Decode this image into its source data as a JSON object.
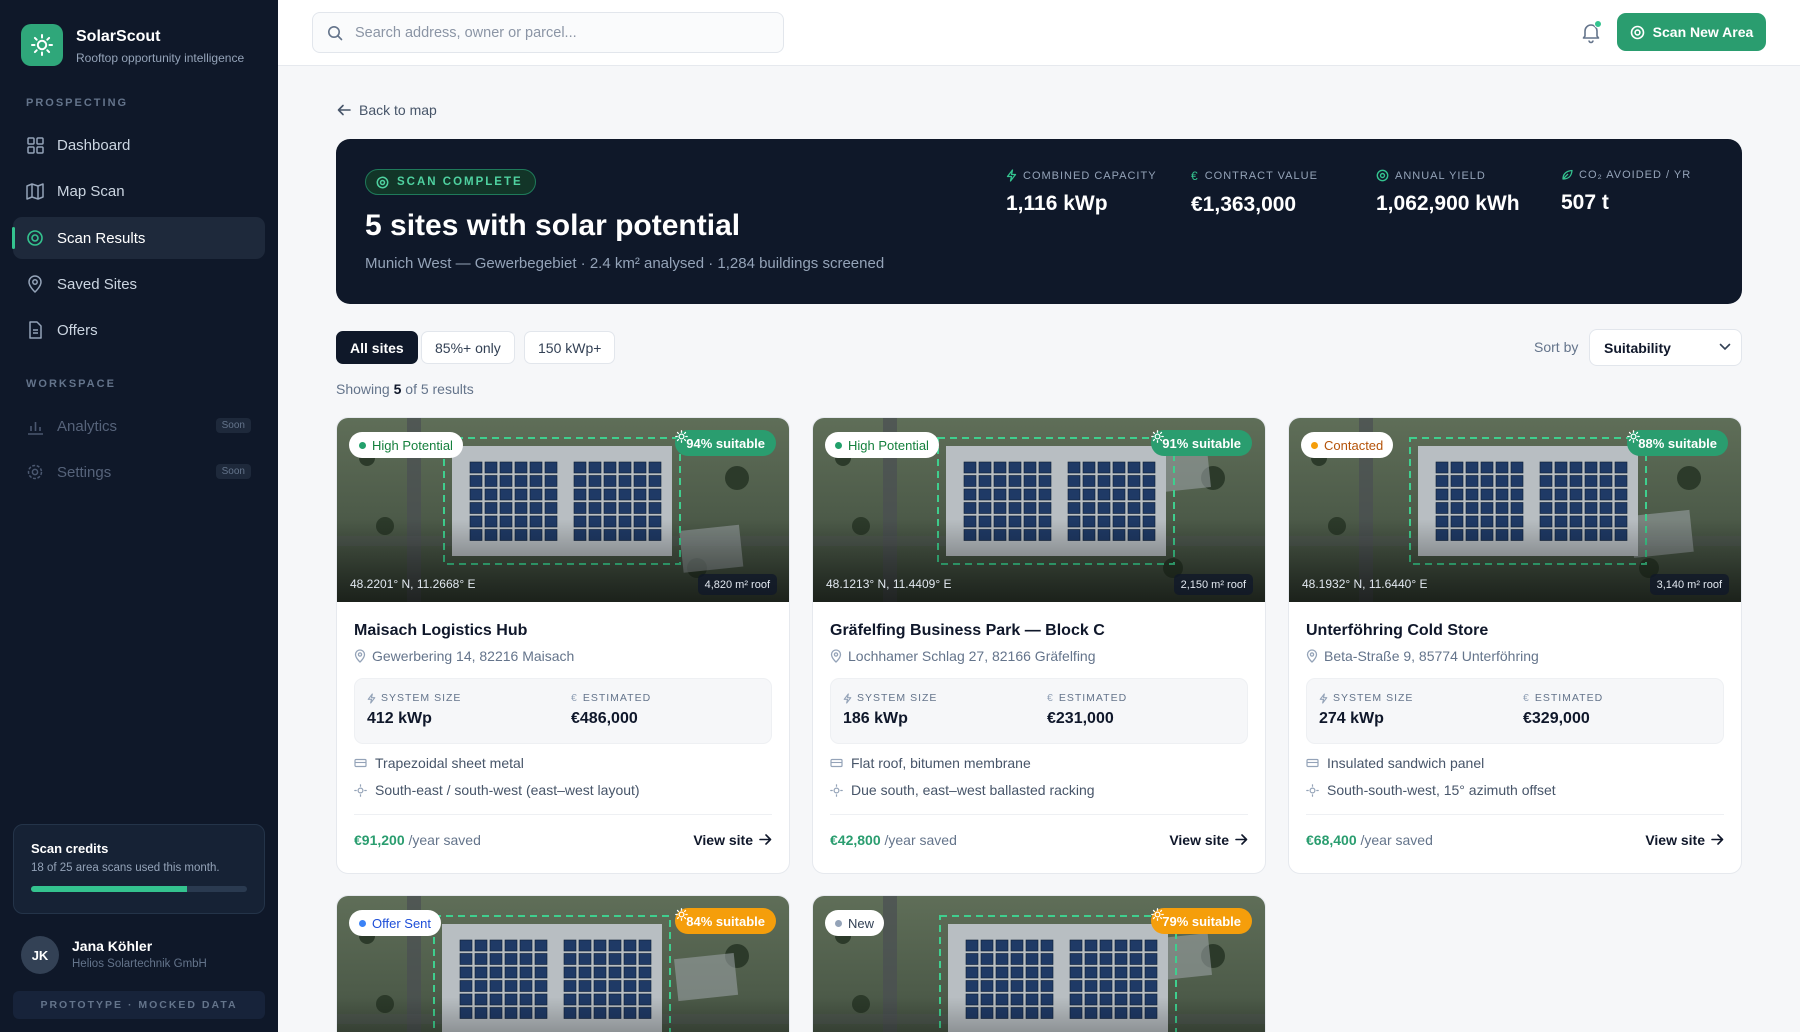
{
  "brand": {
    "name": "SolarScout",
    "tagline": "Rooftop opportunity intelligence"
  },
  "sidebar": {
    "section_prospecting": "PROSPECTING",
    "section_workspace": "WORKSPACE",
    "items": [
      {
        "label": "Dashboard",
        "icon": "grid-icon"
      },
      {
        "label": "Map Scan",
        "icon": "map-icon"
      },
      {
        "label": "Scan Results",
        "icon": "target-icon",
        "active": true
      },
      {
        "label": "Saved Sites",
        "icon": "pin-icon"
      },
      {
        "label": "Offers",
        "icon": "document-icon"
      },
      {
        "label": "Analytics",
        "icon": "bar-chart-icon",
        "badge": "Soon"
      },
      {
        "label": "Settings",
        "icon": "gear-icon",
        "badge": "Soon"
      }
    ],
    "credits": {
      "title": "Scan credits",
      "subtitle": "18 of 25 area scans used this month.",
      "used": 18,
      "total": 25
    },
    "user": {
      "initials": "JK",
      "name": "Jana Köhler",
      "org": "Helios Solartechnik GmbH"
    },
    "footer": "PROTOTYPE · MOCKED DATA"
  },
  "topbar": {
    "search_placeholder": "Search address, owner or parcel...",
    "scan_button": "Scan New Area"
  },
  "back_link": "Back to map",
  "hero": {
    "pill": "SCAN COMPLETE",
    "title": "5 sites with solar potential",
    "subtitle": "Munich West — Gewerbegebiet · 2.4 km² analysed · 1,284 buildings screened",
    "stats": [
      {
        "label": "COMBINED CAPACITY",
        "value": "1,116 kWp",
        "icon": "bolt-icon"
      },
      {
        "label": "CONTRACT VALUE",
        "value": "€1,363,000",
        "icon": "euro-icon"
      },
      {
        "label": "ANNUAL YIELD",
        "value": "1,062,900 kWh",
        "icon": "sun-target-icon"
      },
      {
        "label": "CO₂ AVOIDED / YR",
        "value": "507 t",
        "icon": "leaf-icon"
      }
    ]
  },
  "filters": [
    "All sites",
    "85%+ only",
    "150 kWp+"
  ],
  "sort": {
    "label": "Sort by",
    "value": "Suitability"
  },
  "showing": {
    "prefix": "Showing",
    "count": "5",
    "suffix": "of 5 results"
  },
  "cards": [
    {
      "status": "High Potential",
      "status_color": "#22a06b",
      "suitability": "94% suitable",
      "suit_color": "#2a9d6f",
      "coords": "48.2201° N, 11.2668° E",
      "roof": "4,820 m² roof",
      "name": "Maisach Logistics Hub",
      "address": "Gewerbering 14, 82216 Maisach",
      "system_label": "SYSTEM SIZE",
      "system": "412 kWp",
      "est_label": "ESTIMATED",
      "estimated": "€486,000",
      "feature1": "Trapezoidal sheet metal",
      "feature2": "South-east / south-west (east–west layout)",
      "savings": "€91,200",
      "savings_suffix": "/year saved",
      "view": "View site"
    },
    {
      "status": "High Potential",
      "status_color": "#22a06b",
      "suitability": "91% suitable",
      "suit_color": "#2a9d6f",
      "coords": "48.1213° N, 11.4409° E",
      "roof": "2,150 m² roof",
      "name": "Gräfelfing Business Park — Block C",
      "address": "Lochhamer Schlag 27, 82166 Gräfelfing",
      "system_label": "SYSTEM SIZE",
      "system": "186 kWp",
      "est_label": "ESTIMATED",
      "estimated": "€231,000",
      "feature1": "Flat roof, bitumen membrane",
      "feature2": "Due south, east–west ballasted racking",
      "savings": "€42,800",
      "savings_suffix": "/year saved",
      "view": "View site"
    },
    {
      "status": "Contacted",
      "status_color": "#f59e0b",
      "suitability": "88% suitable",
      "suit_color": "#2a9d6f",
      "coords": "48.1932° N, 11.6440° E",
      "roof": "3,140 m² roof",
      "name": "Unterföhring Cold Store",
      "address": "Beta-Straße 9, 85774 Unterföhring",
      "system_label": "SYSTEM SIZE",
      "system": "274 kWp",
      "est_label": "ESTIMATED",
      "estimated": "€329,000",
      "feature1": "Insulated sandwich panel",
      "feature2": "South-south-west, 15° azimuth offset",
      "savings": "€68,400",
      "savings_suffix": "/year saved",
      "view": "View site"
    },
    {
      "status": "Offer Sent",
      "status_color": "#3b82f6",
      "suitability": "84% suitable",
      "suit_color": "#f59e0b"
    },
    {
      "status": "New",
      "status_color": "#94a3b8",
      "suitability": "79% suitable",
      "suit_color": "#f59e0b"
    }
  ],
  "colors": {
    "accent": "#2a9d6f",
    "sidebar_bg": "#0f1829",
    "hero_bg": "#0f1829"
  }
}
